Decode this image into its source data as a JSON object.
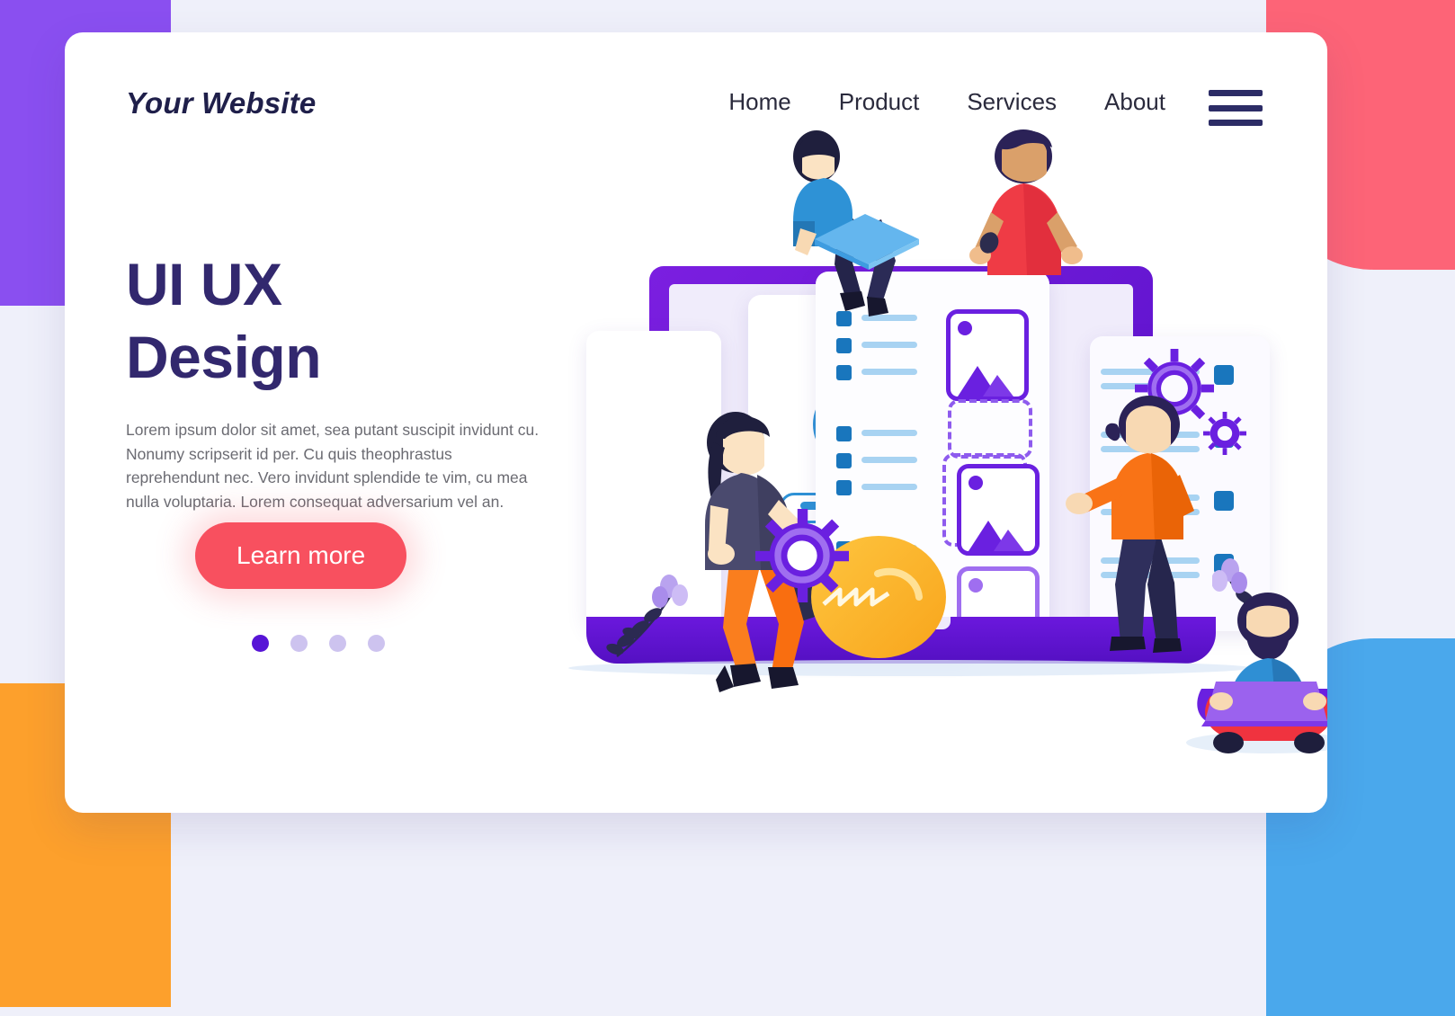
{
  "page": {
    "background_color": "#eff0fa",
    "card_color": "#ffffff"
  },
  "decor": {
    "blobs": [
      {
        "name": "top-left",
        "color": "#8a4ff0"
      },
      {
        "name": "top-right",
        "color": "#fd6477"
      },
      {
        "name": "bottom-left",
        "color": "#fda02c"
      },
      {
        "name": "bottom-right",
        "color": "#4aa8ec"
      }
    ]
  },
  "header": {
    "logo": "Your Website",
    "nav": [
      {
        "label": "Home"
      },
      {
        "label": "Product"
      },
      {
        "label": "Services"
      },
      {
        "label": "About"
      }
    ],
    "menu_icon": "hamburger-menu-icon"
  },
  "hero": {
    "title_line1": "UI UX",
    "title_line2": "Design",
    "title_color": "#32286e",
    "body": "Lorem ipsum dolor sit amet, sea putant suscipit invidunt cu. Nonumy scripserit id per. Cu quis theophrastus reprehendunt nec. Vero invidunt splendide te vim, cu mea nulla voluptaria. Lorem consequat adversarium vel an.",
    "cta_label": "Learn more",
    "cta_color": "#f8505f",
    "carousel": {
      "total_dots": 4,
      "active_index": 0,
      "active_color": "#5714d6",
      "inactive_color": "#cdc3ef"
    }
  },
  "illustration": {
    "name": "ui-ux-design-teamwork-illustration",
    "device": {
      "type": "laptop",
      "frame_color": "#6b18dd",
      "screen_color": "#f0ecfb"
    },
    "login_card": {
      "avatar_color": "#2e92d6",
      "username_value": "",
      "password_value": "*****"
    },
    "image_cards": [
      {
        "state": "dragging",
        "color": "#6a20e0"
      },
      {
        "state": "dropping",
        "color": "#6a20e0"
      },
      {
        "state": "placed",
        "color": "#9f6ef0"
      }
    ],
    "gears": [
      {
        "size": "large",
        "color": "#6a20e0"
      },
      {
        "size": "small",
        "color": "#6a20e0"
      },
      {
        "size": "held",
        "color": "#6a20e0"
      }
    ],
    "lightbulb_color": "#f8a51c",
    "people": [
      {
        "name": "woman-on-laptop-top",
        "shirt": "#2e92d6",
        "hair": "#1f1f3d"
      },
      {
        "name": "man-red-shirt-holding-card",
        "shirt": "#ef3b45",
        "hair": "#2b2257"
      },
      {
        "name": "woman-holding-gear",
        "shirt": "#4a4a6e",
        "pants": "#fa7e1e"
      },
      {
        "name": "man-orange-shirt-arranging",
        "shirt": "#f97316",
        "pants": "#2f2f5c"
      },
      {
        "name": "bearded-man-sitting-laptop",
        "shirt": "#2f8fd4",
        "pants": "#f0333f"
      }
    ]
  }
}
